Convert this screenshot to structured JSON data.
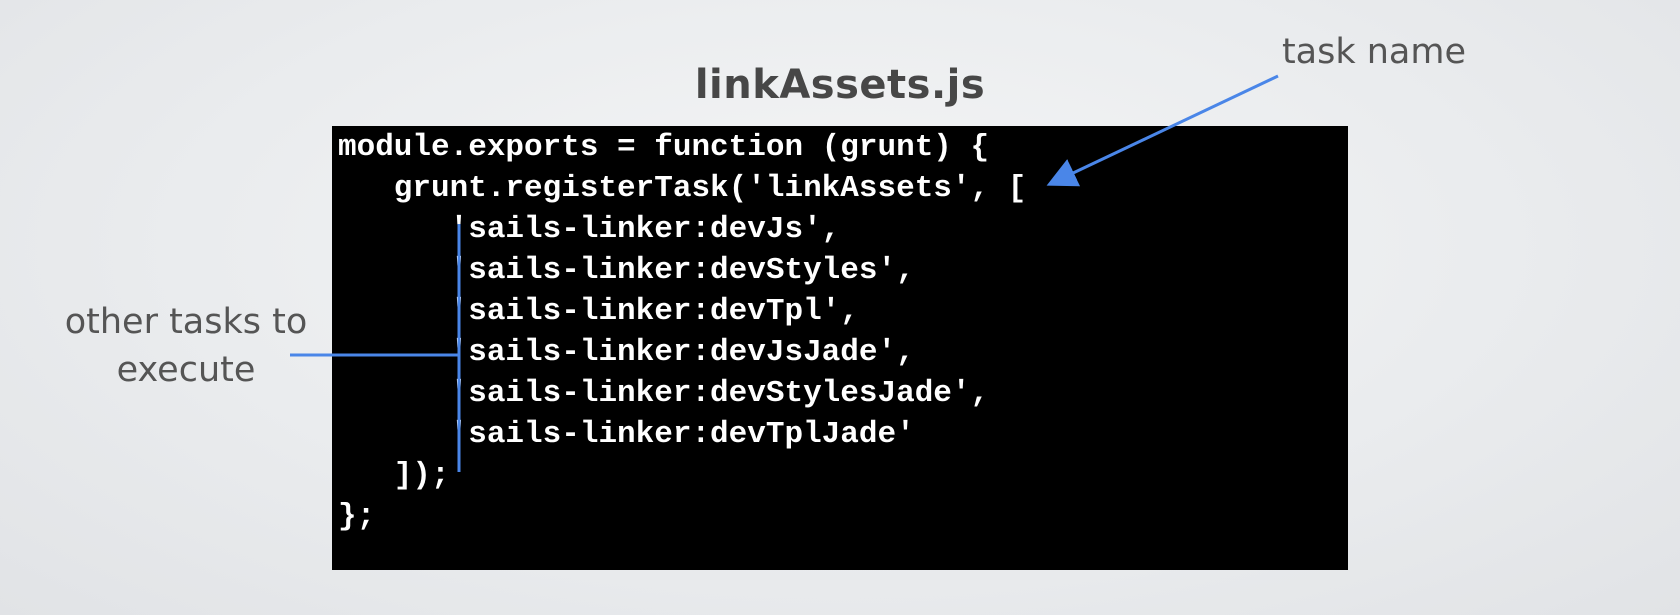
{
  "slide": {
    "file_title": "linkAssets.js"
  },
  "code": {
    "lines": [
      "module.exports = function (grunt) {",
      "   grunt.registerTask('linkAssets', [",
      "      'sails-linker:devJs',",
      "      'sails-linker:devStyles',",
      "      'sails-linker:devTpl',",
      "      'sails-linker:devJsJade',",
      "      'sails-linker:devStylesJade',",
      "      'sails-linker:devTplJade'",
      "   ]);",
      "};"
    ]
  },
  "annotations": {
    "task_name": "task name",
    "other_tasks_line1": "other tasks to",
    "other_tasks_line2": "execute"
  },
  "colors": {
    "background": "#eaecee",
    "code_background": "#000000",
    "code_text": "#ffffff",
    "title_text": "#474747",
    "annotation_text": "#555555",
    "accent_blue": "#4a86e8"
  }
}
